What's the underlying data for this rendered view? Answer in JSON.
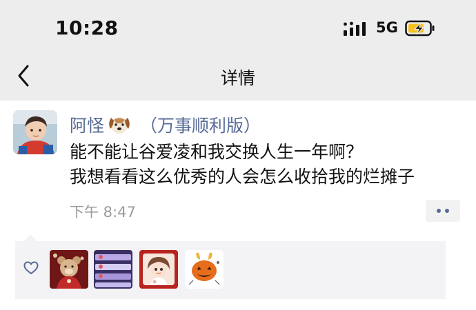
{
  "status_bar": {
    "time": "10:28",
    "network": "5G",
    "icons": [
      "signal-bars-icon",
      "battery-charging-icon"
    ]
  },
  "nav": {
    "title": "详情",
    "back_icon": "chevron-left-icon"
  },
  "post": {
    "author": "阿怪",
    "author_emoji": "dog-face-icon",
    "author_suffix": "（万事顺利版）",
    "text_lines": [
      "能不能让谷爱凌和我交换人生一年啊？",
      "我想看看这么优秀的人会怎么收拾我的烂摊子"
    ],
    "time": "下午 8:47",
    "more_icon": "two-dots-icon"
  },
  "likes": {
    "icon": "heart-outline-icon",
    "avatars": [
      "teddy-bear-avatar",
      "purple-stripes-avatar",
      "cartoon-girl-avatar",
      "pumpkin-avatar"
    ]
  },
  "colors": {
    "name": "#576b95",
    "topbar_bg": "#ededed",
    "likes_bg": "#f3f3f5",
    "time_gray": "#9b9b9b",
    "battery_fill": "#f5c022"
  }
}
